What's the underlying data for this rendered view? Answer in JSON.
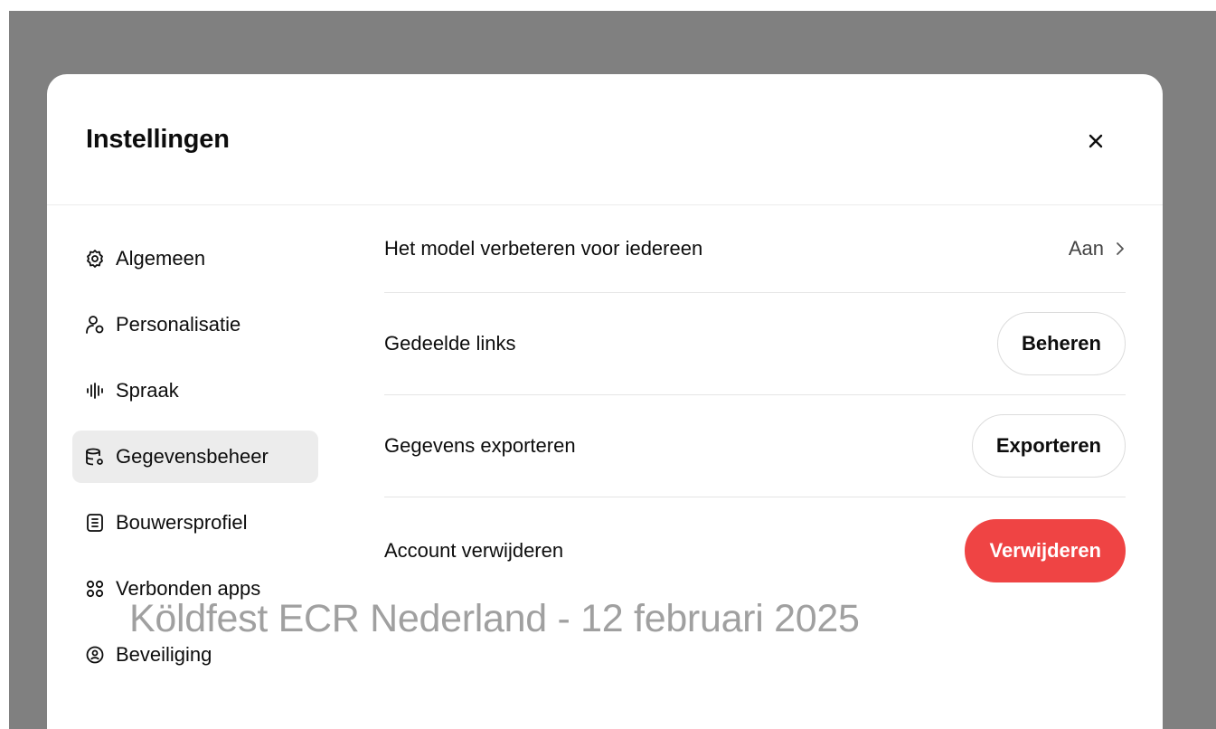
{
  "modal": {
    "title": "Instellingen",
    "close_icon": "close-icon"
  },
  "sidebar": {
    "items": [
      {
        "label": "Algemeen",
        "icon": "gear-icon",
        "active": false
      },
      {
        "label": "Personalisatie",
        "icon": "person-icon",
        "active": false
      },
      {
        "label": "Spraak",
        "icon": "waveform-icon",
        "active": false
      },
      {
        "label": "Gegevensbeheer",
        "icon": "database-icon",
        "active": true
      },
      {
        "label": "Bouwersprofiel",
        "icon": "profile-card-icon",
        "active": false
      },
      {
        "label": "Verbonden apps",
        "icon": "apps-grid-icon",
        "active": false
      },
      {
        "label": "Beveiliging",
        "icon": "shield-lock-icon",
        "active": false
      }
    ]
  },
  "settings": {
    "improve_model": {
      "label": "Het model verbeteren voor iedereen",
      "value": "Aan"
    },
    "shared_links": {
      "label": "Gedeelde links",
      "button": "Beheren"
    },
    "export_data": {
      "label": "Gegevens exporteren",
      "button": "Exporteren"
    },
    "delete_account": {
      "label": "Account verwijderen",
      "button": "Verwijderen"
    }
  },
  "colors": {
    "overlay": "#808080",
    "danger": "#ef4444",
    "active_nav": "#ececec"
  },
  "watermark": {
    "text": "Köldfest ECR Nederland - 12 februari 2025"
  }
}
